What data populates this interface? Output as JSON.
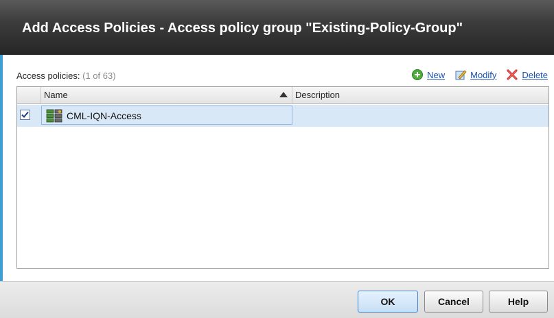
{
  "dialog": {
    "title": "Add Access Policies - Access policy group \"Existing-Policy-Group\""
  },
  "list": {
    "label": "Access policies:",
    "count": "(1 of 63)"
  },
  "actions": {
    "new_label": "New",
    "modify_label": "Modify",
    "delete_label": "Delete"
  },
  "table": {
    "columns": [
      "Name",
      "Description"
    ],
    "sort_column": "Name",
    "sort_direction": "ascending",
    "rows": [
      {
        "checked": true,
        "name": "CML-IQN-Access",
        "description": ""
      }
    ]
  },
  "buttons": {
    "ok": "OK",
    "cancel": "Cancel",
    "help": "Help"
  },
  "colors": {
    "title_bg": "#2b2b2b",
    "accent": "#3ea0d2",
    "selected_row": "#d9e8f7",
    "link": "#1a4fb0"
  }
}
